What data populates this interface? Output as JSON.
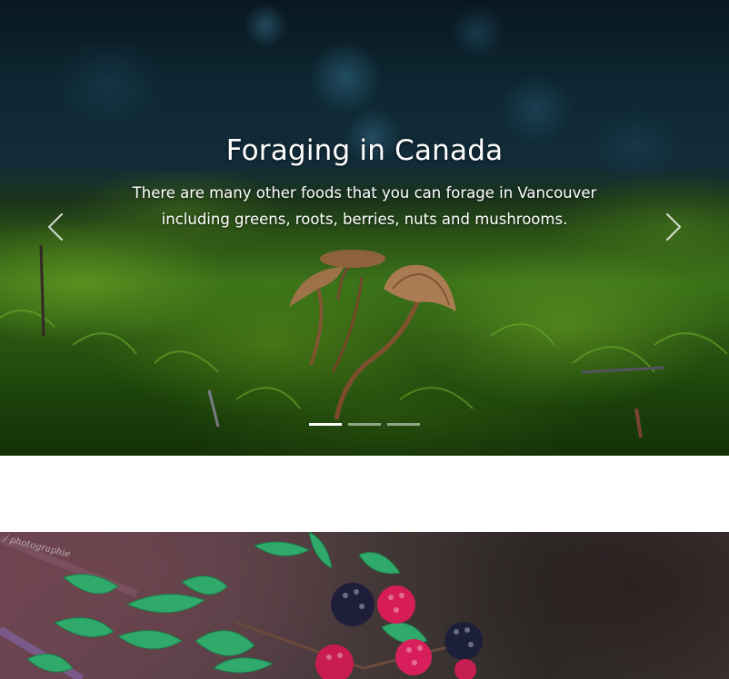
{
  "carousel": {
    "title": "Foraging in Canada",
    "description": "There are many other foods that you can forage in Vancouver including greens, roots, berries, nuts and mushrooms.",
    "prev_icon": "chevron-left-icon",
    "next_icon": "chevron-right-icon",
    "slide_count": 3,
    "active_slide": 1
  },
  "berries_image": {
    "watermark": "/ photographie"
  }
}
